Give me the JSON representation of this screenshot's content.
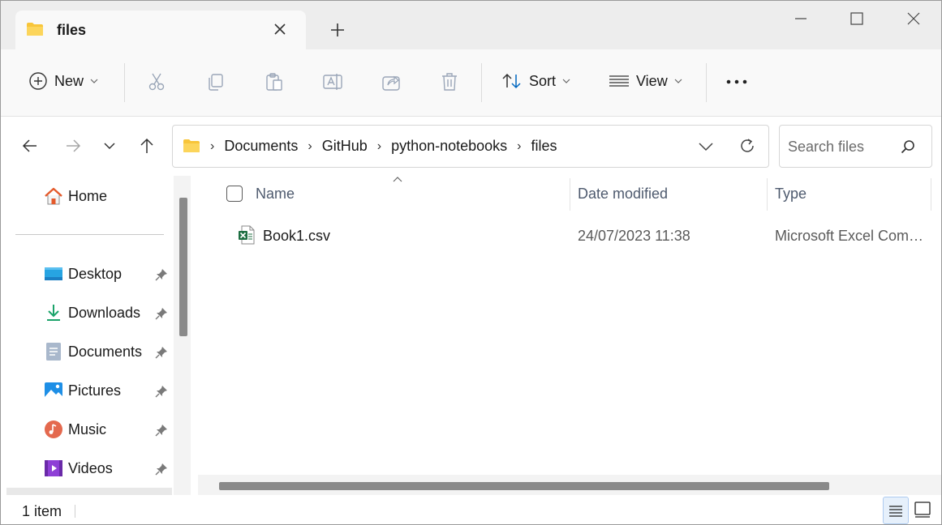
{
  "tab": {
    "title": "files"
  },
  "commandbar": {
    "new_label": "New",
    "sort_label": "Sort",
    "view_label": "View"
  },
  "address": {
    "crumbs": [
      "Documents",
      "GitHub",
      "python-notebooks",
      "files"
    ]
  },
  "search": {
    "placeholder": "Search files"
  },
  "sidebar": {
    "home": "Home",
    "items": [
      {
        "label": "Desktop",
        "icon": "desktop-icon"
      },
      {
        "label": "Downloads",
        "icon": "downloads-icon"
      },
      {
        "label": "Documents",
        "icon": "documents-icon"
      },
      {
        "label": "Pictures",
        "icon": "pictures-icon"
      },
      {
        "label": "Music",
        "icon": "music-icon"
      },
      {
        "label": "Videos",
        "icon": "videos-icon"
      }
    ]
  },
  "columns": {
    "name": "Name",
    "date": "Date modified",
    "type": "Type"
  },
  "files": [
    {
      "name": "Book1.csv",
      "date": "24/07/2023 11:38",
      "type": "Microsoft Excel Com…",
      "icon": "excel-csv-icon"
    }
  ],
  "status": {
    "count": "1 item"
  },
  "colors": {
    "accent": "#0067c0",
    "folder": "#f8c53a",
    "excel": "#1d6f42"
  }
}
